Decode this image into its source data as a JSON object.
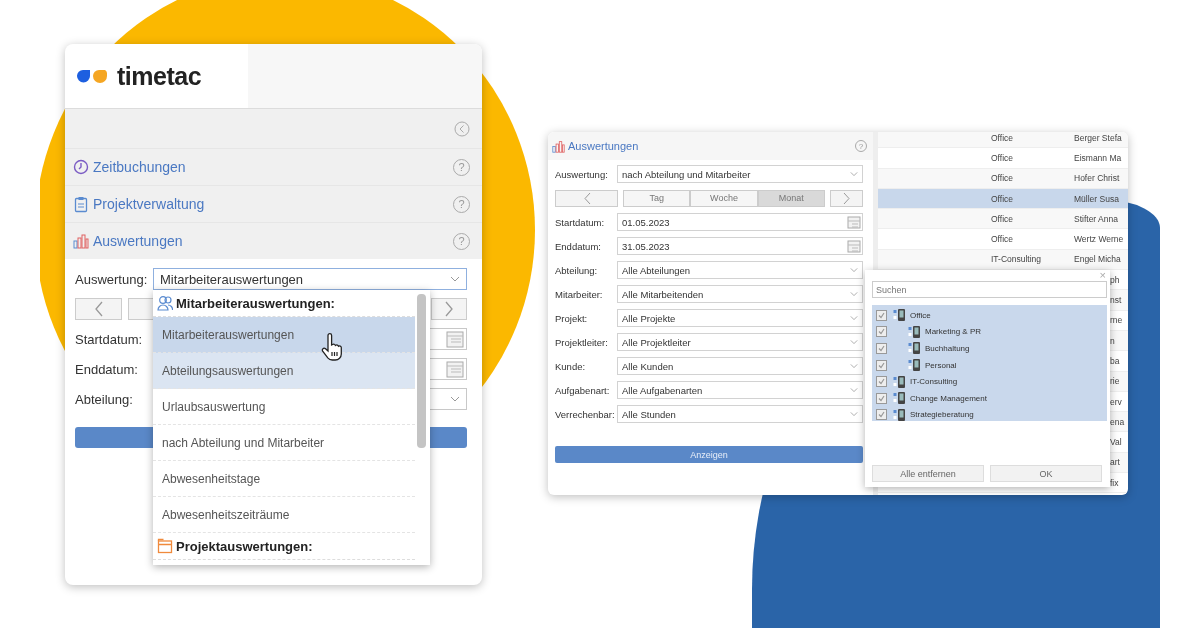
{
  "left_window": {
    "logo": "timetac",
    "nav": [
      {
        "label": "Zeitbuchungen",
        "help": "?"
      },
      {
        "label": "Projektverwaltung",
        "help": "?"
      },
      {
        "label": "Auswertungen",
        "help": "?"
      }
    ],
    "auswertung": {
      "label": "Auswertung:",
      "value": "Mitarbeiterauswertungen"
    },
    "fields": [
      {
        "label": "Startdatum:",
        "kind": "date"
      },
      {
        "label": "Enddatum:",
        "kind": "date"
      },
      {
        "label": "Abteilung:",
        "kind": "select"
      }
    ],
    "dropdown": [
      {
        "kind": "group",
        "label": "Mitarbeiterauswertungen:"
      },
      {
        "kind": "option",
        "label": "Mitarbeiterauswertungen",
        "selected": true,
        "highlighted": false
      },
      {
        "kind": "option",
        "label": "Abteilungsauswertungen",
        "selected": false,
        "highlighted": true
      },
      {
        "kind": "option",
        "label": "Urlaubsauswertung",
        "selected": false,
        "highlighted": false
      },
      {
        "kind": "option",
        "label": "nach Abteilung und Mitarbeiter",
        "selected": false,
        "highlighted": false
      },
      {
        "kind": "option",
        "label": "Abwesenheitstage",
        "selected": false,
        "highlighted": false
      },
      {
        "kind": "option",
        "label": "Abwesenheitszeiträume",
        "selected": false,
        "highlighted": false
      },
      {
        "kind": "group",
        "label": "Projektauswertungen:"
      }
    ]
  },
  "right_window": {
    "title": "Auswertungen",
    "help": "?",
    "fields": [
      {
        "label": "Auswertung:",
        "value": "nach Abteilung und Mitarbeiter",
        "kind": "select"
      },
      {
        "kind": "periods",
        "periods": [
          {
            "label": "Tag",
            "selected": false
          },
          {
            "label": "Woche",
            "selected": false
          },
          {
            "label": "Monat",
            "selected": true
          }
        ]
      },
      {
        "label": "Startdatum:",
        "value": "01.05.2023",
        "kind": "date"
      },
      {
        "label": "Enddatum:",
        "value": "31.05.2023",
        "kind": "date"
      },
      {
        "label": "Abteilung:",
        "value": "Alle Abteilungen",
        "kind": "select"
      },
      {
        "label": "Mitarbeiter:",
        "value": "Alle Mitarbeitenden",
        "kind": "select"
      },
      {
        "label": "Projekt:",
        "value": "Alle Projekte",
        "kind": "select"
      },
      {
        "label": "Projektleiter:",
        "value": "Alle Projektleiter",
        "kind": "select"
      },
      {
        "label": "Kunde:",
        "value": "Alle Kunden",
        "kind": "select"
      },
      {
        "label": "Aufgabenart:",
        "value": "Alle Aufgabenarten",
        "kind": "select"
      },
      {
        "label": "Verrechenbar:",
        "value": "Alle Stunden",
        "kind": "select"
      }
    ],
    "button": "Anzeigen",
    "table_rows": [
      {
        "kind": "row",
        "department": "Office",
        "name": "Berger Stefa",
        "selected": false
      },
      {
        "kind": "row",
        "department": "Office",
        "name": "Eismann Ma",
        "selected": false
      },
      {
        "kind": "row",
        "department": "Office",
        "name": "Hofer Christ",
        "selected": false
      },
      {
        "kind": "row",
        "department": "Office",
        "name": "Müller Susa",
        "selected": true
      },
      {
        "kind": "row",
        "department": "Office",
        "name": "Stifter Anna",
        "selected": false
      },
      {
        "kind": "row",
        "department": "Office",
        "name": "Wertz Werne",
        "selected": false
      },
      {
        "kind": "row",
        "department": "IT-Consulting",
        "name": "Engel Micha",
        "selected": false
      },
      {
        "kind": "covered",
        "name": "ph"
      },
      {
        "kind": "covered",
        "name": "nst"
      },
      {
        "kind": "covered",
        "name": "rne"
      },
      {
        "kind": "covered",
        "name": "n"
      },
      {
        "kind": "covered",
        "name": "ba"
      },
      {
        "kind": "covered",
        "name": "rie"
      },
      {
        "kind": "covered",
        "name": "erv"
      },
      {
        "kind": "covered",
        "name": "ena"
      },
      {
        "kind": "covered",
        "name": "Val"
      },
      {
        "kind": "covered",
        "name": "art"
      },
      {
        "kind": "covered",
        "name": "fix"
      }
    ],
    "popup": {
      "close": "×",
      "search_placeholder": "Suchen",
      "tree": [
        {
          "label": "Office",
          "checked": true,
          "children": [
            {
              "label": "Marketing & PR",
              "checked": true
            },
            {
              "label": "Buchhaltung",
              "checked": true
            },
            {
              "label": "Personal",
              "checked": true
            }
          ]
        },
        {
          "label": "IT-Consulting",
          "checked": true
        },
        {
          "label": "Change Management",
          "checked": true
        },
        {
          "label": "Strategieberatung",
          "checked": true
        }
      ],
      "buttons": [
        "Alle entfernen",
        "OK"
      ]
    }
  }
}
